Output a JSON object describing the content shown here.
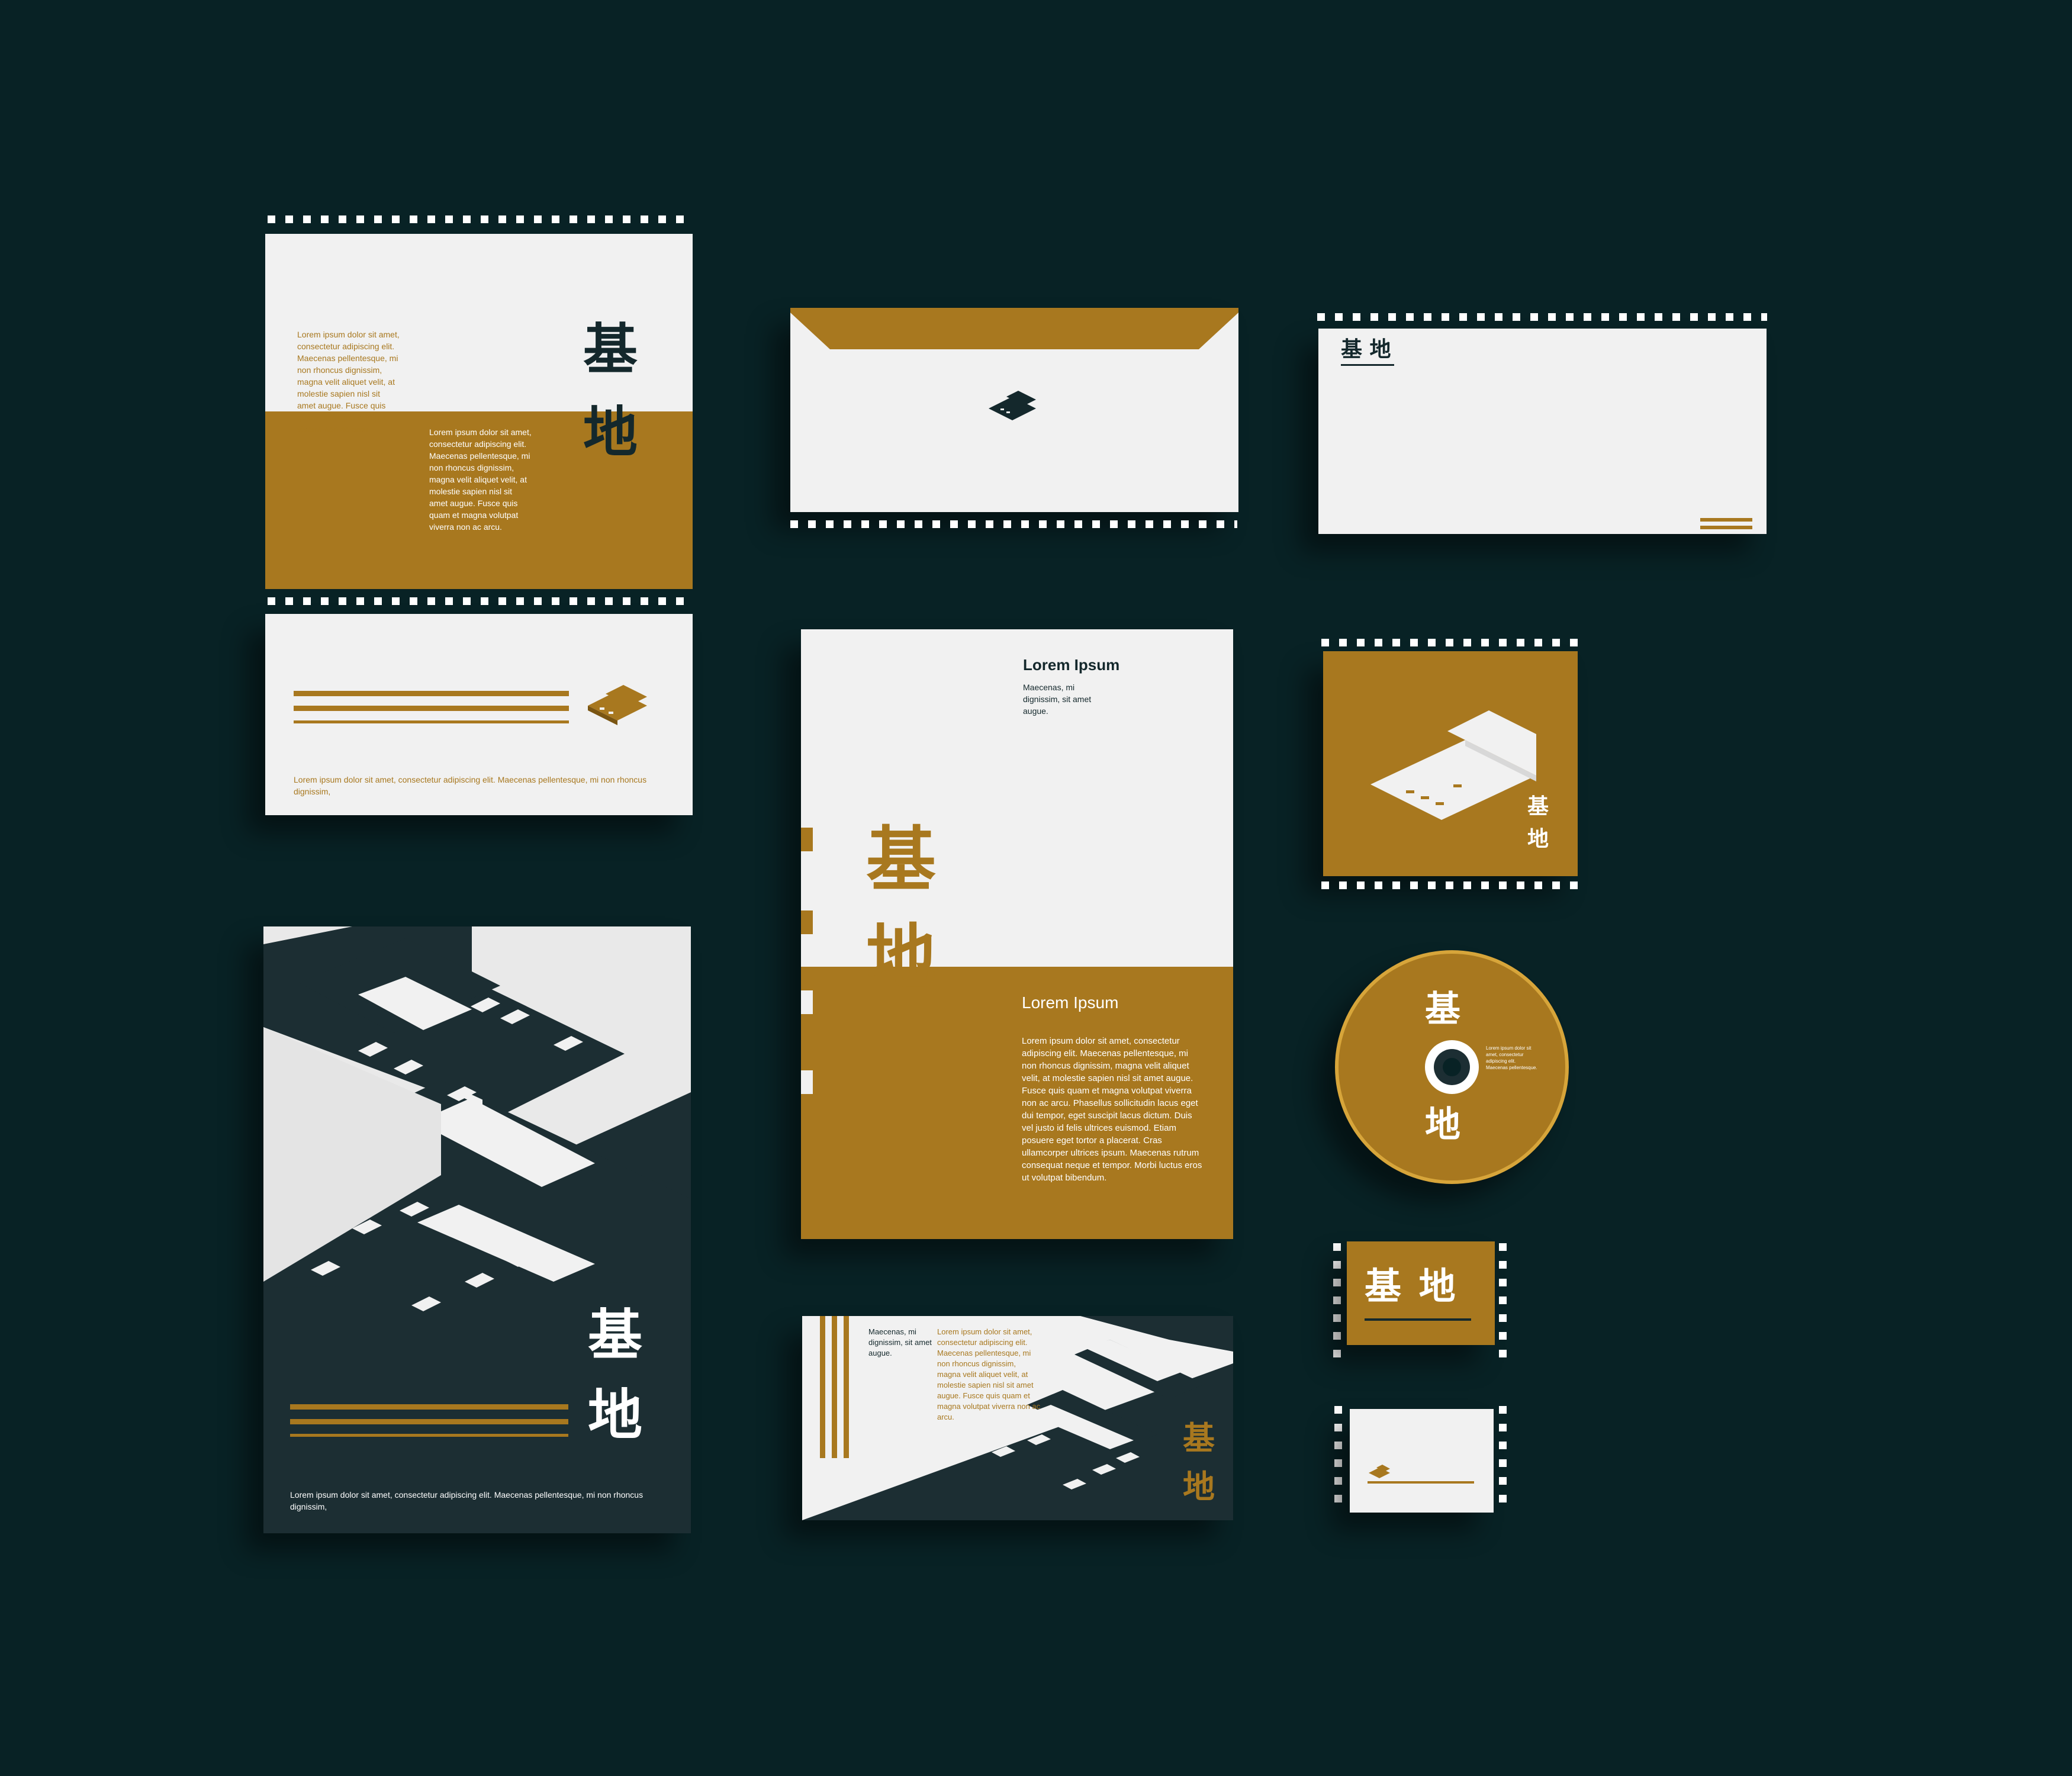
{
  "brand": {
    "logo_char_1": "基",
    "logo_char_2": "地",
    "logo_full": "基 地"
  },
  "colors": {
    "background": "#082225",
    "gold": "#a8781f",
    "paper": "#f1f1f1",
    "dark": "#1c2e33"
  },
  "brochure": {
    "col1_text": "Lorem ipsum dolor sit amet, consectetur adipiscing elit. Maecenas pellentesque, mi non rhoncus dignissim, magna velit aliquet velit, at molestie sapien nisl sit amet augue. Fusce quis quam et magna volutpat viverra non ac arcu.",
    "col2_text": "Lorem ipsum dolor sit amet, consectetur adipiscing elit. Maecenas pellentesque, mi non rhoncus dignissim, magna velit aliquet velit, at molestie sapien nisl sit amet augue. Fusce quis quam et magna volutpat viverra non ac arcu."
  },
  "card_small": {
    "caption": "Lorem ipsum dolor sit amet, consectetur adipiscing elit. Maecenas pellentesque, mi non rhoncus dignissim,"
  },
  "poster": {
    "caption": "Lorem ipsum dolor sit amet, consectetur adipiscing elit. Maecenas pellentesque, mi non rhoncus dignissim,"
  },
  "folder": {
    "heading_top": "Lorem Ipsum",
    "sub_top": "Maecenas, mi dignissim, sit amet augue.",
    "heading_mid": "Lorem Ipsum",
    "body": "Lorem ipsum dolor sit amet, consectetur adipiscing elit. Maecenas pellentesque, mi non rhoncus dignissim, magna velit aliquet velit, at molestie sapien nisl sit amet augue. Fusce quis quam et magna volutpat viverra non ac arcu. Phasellus sollicitudin lacus eget dui tempor, eget suscipit lacus dictum. Duis vel justo id felis ultrices euismod. Etiam posuere eget tortor a placerat. Cras ullamcorper ultrices ipsum. Maecenas rutrum consequat neque et tempor. Morbi luctus eros ut volutpat bibendum."
  },
  "flyer": {
    "left_text": "Maecenas, mi dignissim, sit amet augue.",
    "gold_text": "Lorem ipsum dolor sit amet, consectetur adipiscing elit. Maecenas pellentesque, mi non rhoncus dignissim, magna velit aliquet velit, at molestie sapien nisl sit amet augue. Fusce quis quam et magna volutpat viverra non ac arcu."
  },
  "cd": {
    "text": "Lorem ipsum dolor sit amet, consectetur adipiscing elit. Maecenas pellentesque."
  }
}
